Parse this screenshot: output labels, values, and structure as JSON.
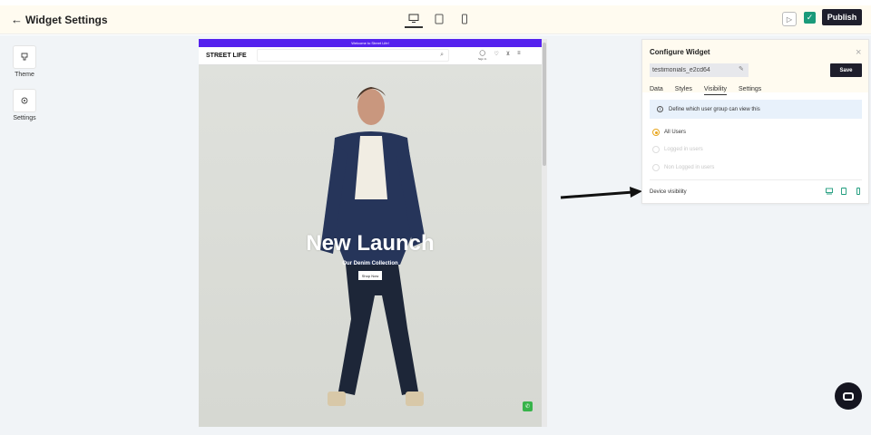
{
  "header": {
    "title": "Widget Settings",
    "publish_label": "Publish",
    "devices": [
      "desktop-icon",
      "tablet-icon",
      "mobile-icon"
    ],
    "active_device": "desktop"
  },
  "left_tools": [
    {
      "label": "Theme",
      "icon": "brush-icon"
    },
    {
      "label": "Settings",
      "icon": "gear-icon"
    }
  ],
  "preview": {
    "announcement": "Welcome to Street Life!",
    "logo": "STREET LIFE",
    "signin_label": "Sign In",
    "hero_title": "New Launch",
    "hero_subtitle": "Our Denim Collection",
    "cta": "Shop Now"
  },
  "panel": {
    "title": "Configure Widget",
    "widget_name": "testimonials_e2cd64",
    "save_label": "Save",
    "tabs": [
      "Data",
      "Styles",
      "Visibility",
      "Settings"
    ],
    "active_tab": "Visibility",
    "info_text": "Define which user group can view this",
    "options": [
      {
        "label": "All Users",
        "selected": true,
        "enabled": true
      },
      {
        "label": "Logged in users",
        "selected": false,
        "enabled": false
      },
      {
        "label": "Non Logged in users",
        "selected": false,
        "enabled": false
      }
    ],
    "device_visibility_label": "Device visibility"
  },
  "colors": {
    "accent": "#1a9a7a",
    "dark": "#1e1e2c",
    "announcement": "#5522ee",
    "radio": "#e8a61e",
    "whatsapp": "#37b34a"
  }
}
